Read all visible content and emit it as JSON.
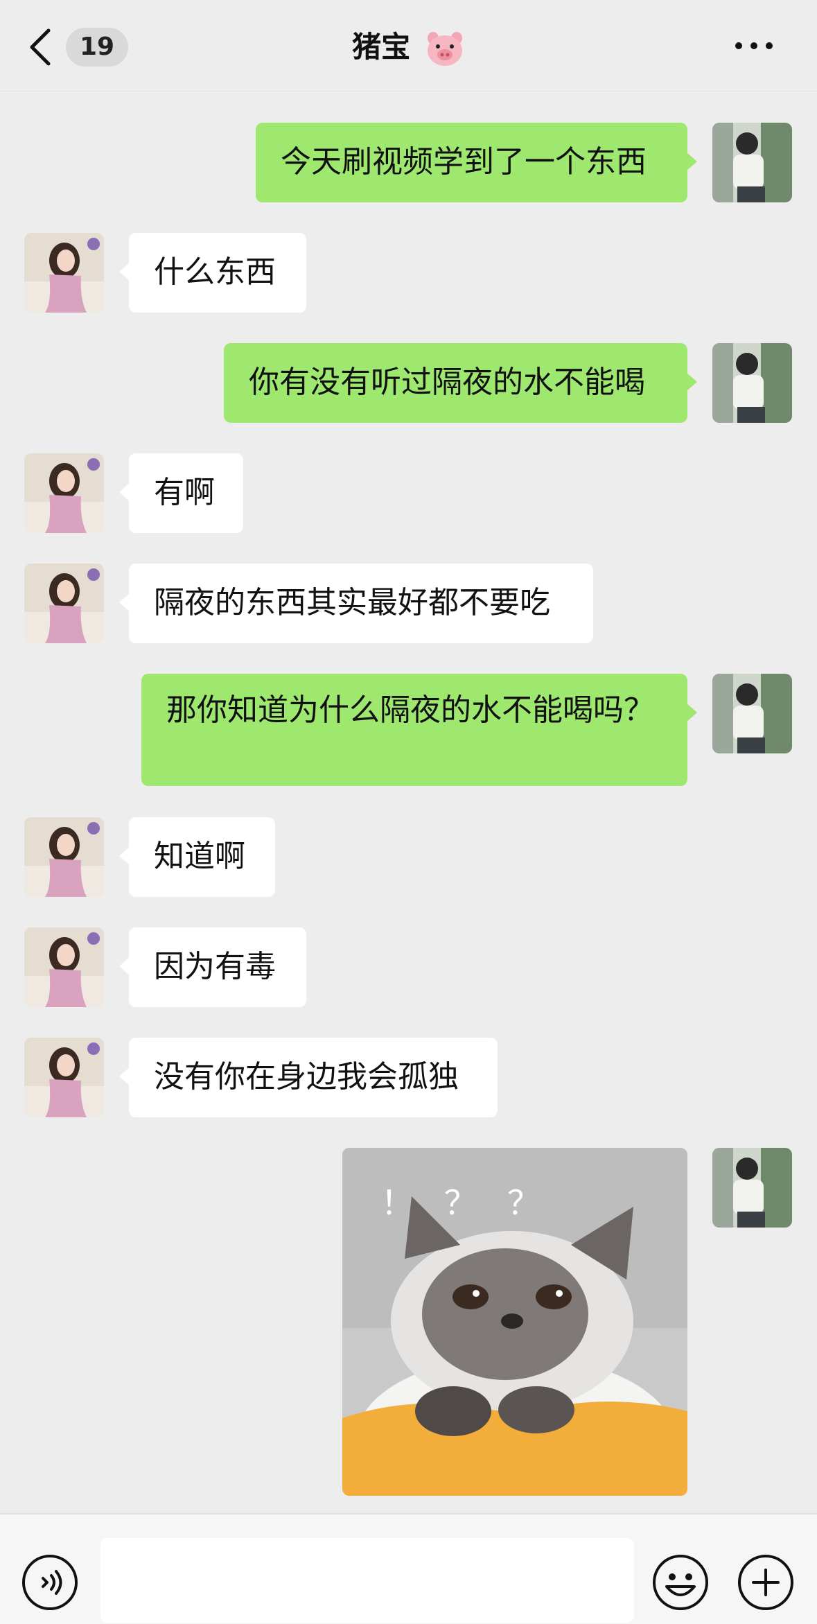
{
  "header": {
    "unread_count": "19",
    "title": "猪宝",
    "title_emoji": "pig-face-icon"
  },
  "messages": [
    {
      "side": "out",
      "text": "今天刷视频学到了一个东西"
    },
    {
      "side": "in",
      "text": "什么东西"
    },
    {
      "side": "out",
      "text": "你有没有听过隔夜的水不能喝"
    },
    {
      "side": "in",
      "text": "有啊"
    },
    {
      "side": "in",
      "text": "隔夜的东西其实最好都不要吃"
    },
    {
      "side": "out",
      "text": "那你知道为什么隔夜的水不能喝吗？"
    },
    {
      "side": "in",
      "text": "知道啊"
    },
    {
      "side": "in",
      "text": "因为有毒"
    },
    {
      "side": "in",
      "text": "没有你在身边我会孤独"
    },
    {
      "side": "out",
      "type": "sticker",
      "sticker": "confused-cat-sticker",
      "sticker_text": "！ ？ ？"
    }
  ],
  "input": {
    "placeholder": ""
  },
  "colors": {
    "background": "#ededed",
    "outgoing_bubble": "#9ee870",
    "incoming_bubble": "#ffffff",
    "bottom_bar": "#f6f6f6"
  },
  "icons": {
    "back": "chevron-left-icon",
    "more": "more-dots-icon",
    "voice": "voice-icon",
    "emoji": "emoji-icon",
    "plus": "plus-icon"
  }
}
